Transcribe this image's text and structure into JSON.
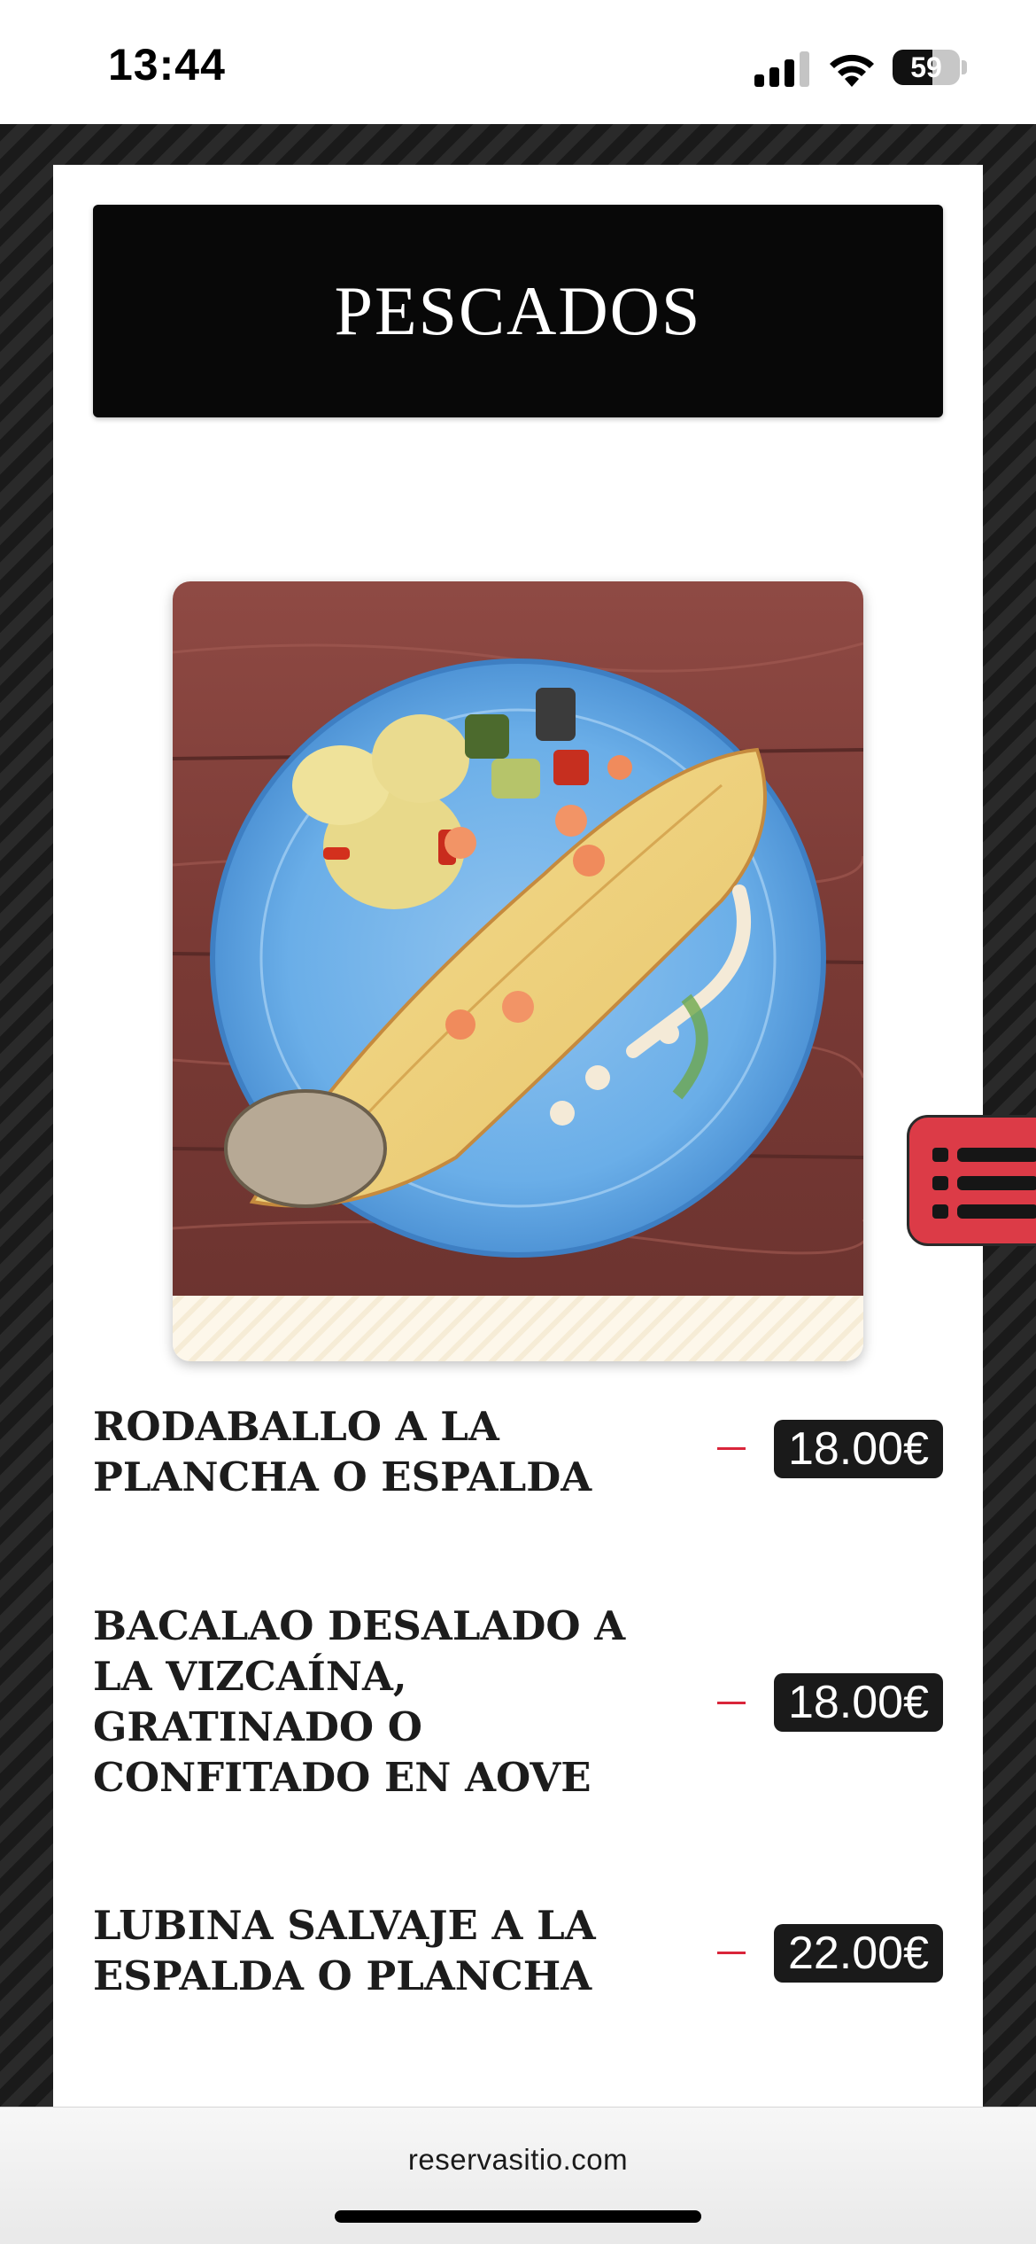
{
  "status_bar": {
    "time": "13:44",
    "battery": "59",
    "battery_level": 0.59,
    "icons": [
      "signal-icon",
      "wifi-icon",
      "battery-icon"
    ]
  },
  "section": {
    "title": "PESCADOS"
  },
  "photo": {
    "description_icon": "dish-photo"
  },
  "menu_items": [
    {
      "name": "RODABALLO A LA PLANCHA O ESPALDA",
      "price": "18.00€"
    },
    {
      "name": "BACALAO DESALADO A LA VIZCAÍNA, GRATINADO O CONFITADO EN AOVE",
      "price": "18.00€"
    },
    {
      "name": "LUBINA SALVAJE A LA ESPALDA O PLANCHA",
      "price": "22.00€"
    }
  ],
  "floating_tab": {
    "icon": "list-icon"
  },
  "browser": {
    "url": "reservasitio.com"
  },
  "colors": {
    "accent_red": "#dc3b47",
    "dash_red": "#d9253a",
    "header_black": "#080808",
    "price_badge": "#1a1a1a"
  }
}
